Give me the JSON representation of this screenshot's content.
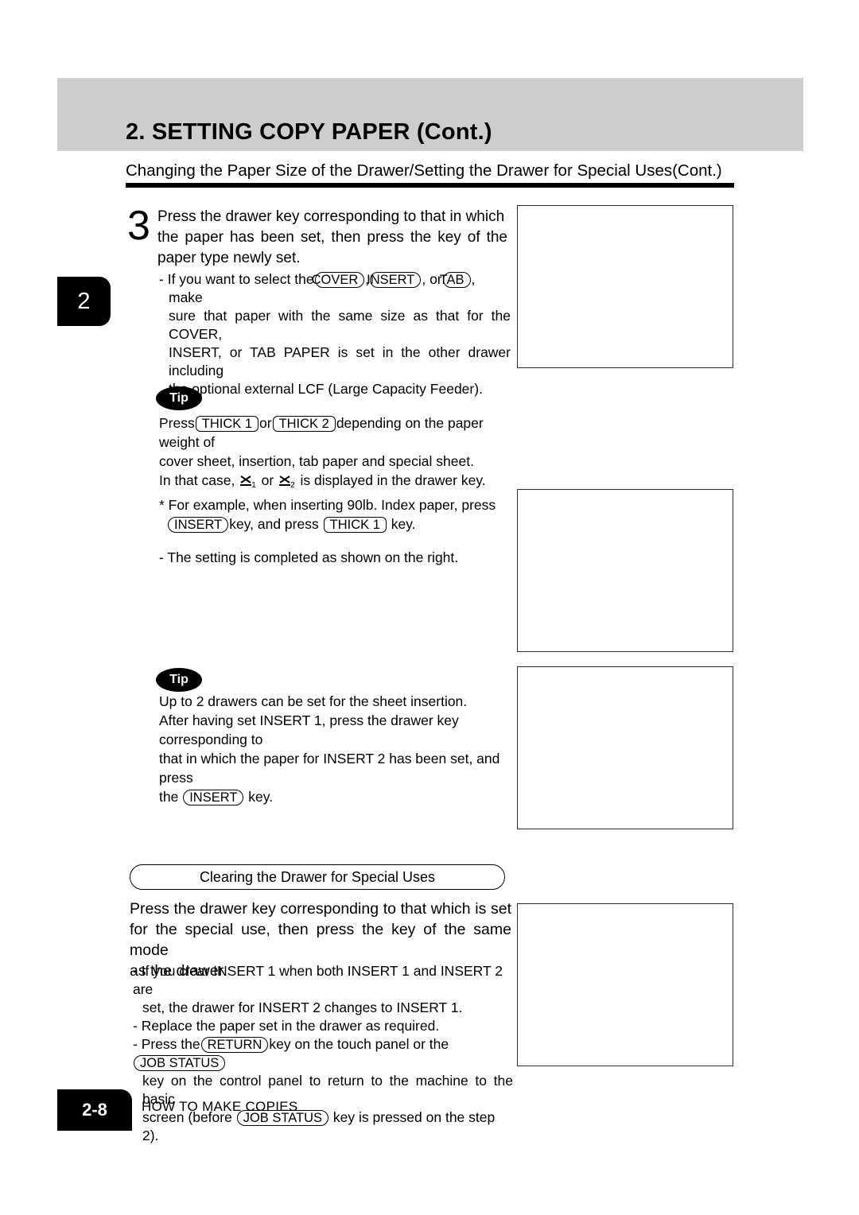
{
  "header": {
    "title": "2. SETTING COPY PAPER (Cont.)",
    "subtitle": "Changing the Paper Size of the Drawer/Setting the Drawer for Special Uses(Cont.)"
  },
  "chapter_tab": {
    "label": "2"
  },
  "step": {
    "number": "3",
    "line1": "Press the drawer key corresponding to that in which",
    "line2": "the paper has been set, then press the key of the",
    "line3": "paper type newly set.",
    "note": {
      "dash": "-",
      "pre": "If you want to select the",
      "key_cover": "COVER",
      "sep1": ",",
      "key_insert": "INSERT",
      "sep2": ", or",
      "key_tab": "TAB",
      "post": ", make",
      "line2": "sure that paper with the same size as that for the COVER,",
      "line3": "INSERT, or TAB PAPER is set in the other drawer including",
      "line4": "the optional external LCF (Large Capacity Feeder)."
    }
  },
  "tip1": {
    "badge": "Tip",
    "l1_pre": "Press",
    "l1_key1": "THICK 1",
    "l1_mid": "or",
    "l1_key2": "THICK 2",
    "l1_post": "depending on the paper weight of",
    "l2": "cover sheet, insertion, tab paper and special sheet.",
    "l3_pre": "In that case,",
    "l3_sub1": "1",
    "l3_mid": "or",
    "l3_sub2": "2",
    "l3_post": "is displayed in the drawer key.",
    "l4": "* For example, when inserting 90lb. Index paper, press",
    "l5_key": "INSERT",
    "l5_mid": "key, and press",
    "l5_key2": "THICK 1",
    "l5_post": "key.",
    "l6": "- The setting is completed as shown on the right."
  },
  "tip2": {
    "badge": "Tip",
    "l1": "Up to 2 drawers can be set for the sheet insertion.",
    "l2": "After having set INSERT 1,  press the drawer key corresponding to",
    "l3": "that in which the paper for INSERT 2 has been set, and press",
    "l4_pre": "the",
    "l4_key": "INSERT",
    "l4_post": "key."
  },
  "clearing": {
    "heading": "Clearing the Drawer for Special Uses",
    "intro_l1": "Press the drawer key corresponding to that which is set",
    "intro_l2": "for the special use, then press the key of the same mode",
    "intro_l3": "as the drawer.",
    "note1_l1": "- If you clear INSERT 1 when both INSERT 1 and INSERT 2 are",
    "note1_l2": "set, the drawer for INSERT 2 changes to INSERT 1.",
    "note2": "- Replace the paper set in the drawer as required.",
    "note3_pre": "- Press the",
    "note3_key1": "RETURN",
    "note3_mid": "key on the touch panel or the",
    "note3_key2": "JOB STATUS",
    "note3_l2": "key on the control panel to return to the machine to the basic",
    "note3_l3_pre": "screen (before",
    "note3_key3": "JOB STATUS",
    "note3_l3_post": "key is pressed on the step 2)."
  },
  "footer": {
    "page": "2-8",
    "chapter": "HOW TO MAKE COPIES"
  }
}
